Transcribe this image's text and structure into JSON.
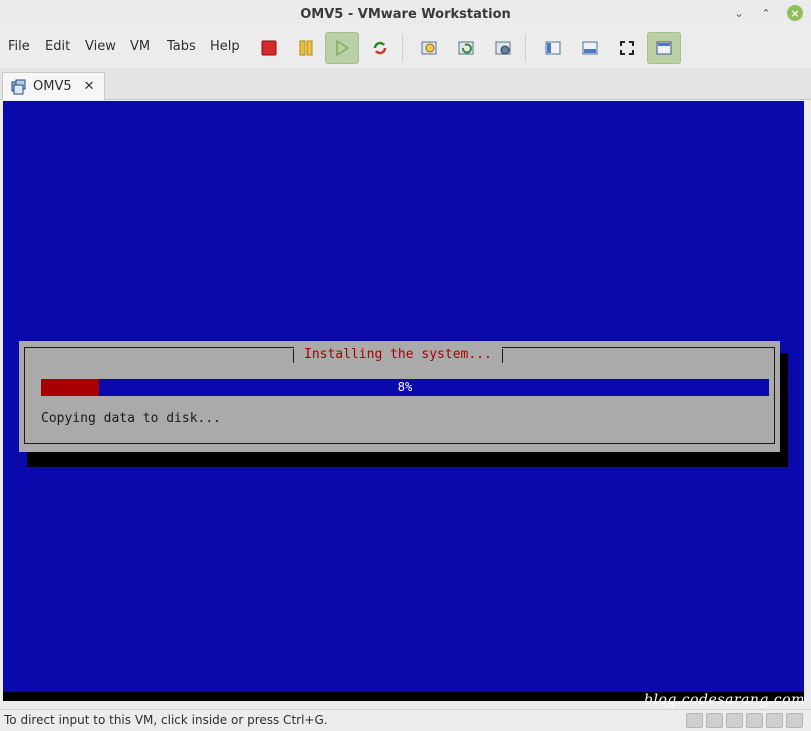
{
  "window": {
    "title": "OMV5 - VMware Workstation"
  },
  "menu": {
    "items": [
      "File",
      "Edit",
      "View",
      "VM",
      "Tabs",
      "Help"
    ]
  },
  "toolbar": {
    "buttons": [
      {
        "name": "power-off-icon",
        "color": "#d42a2a"
      },
      {
        "name": "pause-icon",
        "color": "#e8c23a"
      },
      {
        "name": "play-icon",
        "color": "#7cb35a"
      },
      {
        "name": "restart-icon",
        "color": "#c93a2a"
      },
      {
        "name": "snapshot-icon"
      },
      {
        "name": "revert-snapshot-icon"
      },
      {
        "name": "snapshot-manager-icon"
      },
      {
        "name": "sidebar-toggle-icon"
      },
      {
        "name": "thumbnail-bar-icon"
      },
      {
        "name": "fullscreen-icon"
      },
      {
        "name": "unity-view-icon"
      }
    ]
  },
  "tabs": [
    {
      "label": "OMV5",
      "close": "✕"
    }
  ],
  "installer": {
    "title": "Installing the system...",
    "progress_percent": 8,
    "progress_label": "8%",
    "message": "Copying data to disk...",
    "colors": {
      "background": "#0a0aac",
      "dialog": "#aaaaaa",
      "accent": "#a80000"
    }
  },
  "watermark": "blog.codesarang.com",
  "statusbar": {
    "text": "To direct input to this VM, click inside or press Ctrl+G.",
    "devices": [
      "hard-disk-icon",
      "cd-rom-icon",
      "network-icon",
      "usb-icon",
      "printer-icon",
      "sound-icon"
    ]
  }
}
